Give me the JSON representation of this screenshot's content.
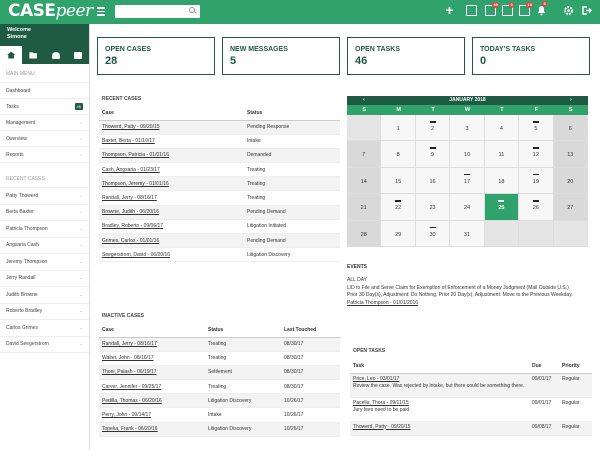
{
  "app": {
    "logo_case": "CASE",
    "logo_peer": "peer"
  },
  "topbar": {
    "search_placeholder": "",
    "badges": {
      "tasks": "40",
      "messages": "5",
      "inbox": "18",
      "alerts": "5"
    }
  },
  "sidebar": {
    "welcome": "Welcome",
    "user": "Simone",
    "main_menu_label": "MAIN MENU",
    "menu": [
      {
        "label": "Dashboard",
        "count": "",
        "chevron": false
      },
      {
        "label": "Tasks",
        "count": "46",
        "chevron": false
      },
      {
        "label": "Management",
        "count": "",
        "chevron": true
      },
      {
        "label": "Overview",
        "count": "",
        "chevron": true
      },
      {
        "label": "Reports",
        "count": "",
        "chevron": true
      }
    ],
    "recent_label": "RECENT CASES",
    "recent": [
      "Patty Thowerd",
      "Berta Baxter",
      "Patricia Thompson",
      "Angsaria Cash",
      "Jeremy Thompson",
      "Jerry Randall",
      "Judith Browne",
      "Roberto Bradley",
      "Carlos Grimes",
      "David Seegerstrom"
    ]
  },
  "cards": [
    {
      "label": "OPEN CASES",
      "value": "28"
    },
    {
      "label": "NEW MESSAGES",
      "value": "5"
    },
    {
      "label": "OPEN TASKS",
      "value": "46"
    },
    {
      "label": "TODAY'S TASKS",
      "value": "0"
    }
  ],
  "recent_cases": {
    "title": "RECENT CASES",
    "headers": [
      "Case",
      "Status"
    ],
    "rows": [
      [
        "Thowerd, Patty - 09/20/15",
        "Pending Response"
      ],
      [
        "Baxter, Berta - 01/10/17",
        "Intake"
      ],
      [
        "Thompson, Patricia - 01/01/16",
        "Demanded"
      ],
      [
        "Cash, Angsaria - 01/23/17",
        "Treating"
      ],
      [
        "Thompson, Jeremy - 01/01/16",
        "Treating"
      ],
      [
        "Randall, Jerry - 08/16/17",
        "Treating"
      ],
      [
        "Browne, Judith - 06/20/16",
        "Pending Demand"
      ],
      [
        "Bradley, Roberto - 09/06/17",
        "Litigation Initiated"
      ],
      [
        "Grimes, Carlos - 01/01/16",
        "Pending Demand"
      ],
      [
        "Seegerstrom, David - 06/20/16",
        "Litigation Discovery"
      ]
    ]
  },
  "inactive_cases": {
    "title": "INACTIVE CASES",
    "headers": [
      "Case",
      "Status",
      "Last Touched"
    ],
    "rows": [
      [
        "Randall, Jerry - 08/16/17",
        "Treating",
        "08/30/17"
      ],
      [
        "Walter, John - 08/16/17",
        "Treating",
        "08/30/17"
      ],
      [
        "Thoni, Palash - 06/19/17",
        "Settlement",
        "08/30/17"
      ],
      [
        "Carver, Jennifer - 09/25/17",
        "Treating",
        "08/30/17"
      ],
      [
        "Pedilla, Thomas - 06/20/16",
        "Litigation Discovery",
        "10/26/17"
      ],
      [
        "Perry, John - 09/14/17",
        "Intake",
        "10/26/17"
      ],
      [
        "Topeka, Frank - 06/20/16",
        "Litigation Discovery",
        "10/26/17"
      ]
    ]
  },
  "calendar": {
    "title": "JANUARY 2018",
    "prev": "‹",
    "next": "›",
    "days": [
      "S",
      "M",
      "T",
      "W",
      "T",
      "F",
      "S"
    ],
    "weeks": [
      [
        [
          "",
          0
        ],
        [
          "1",
          0
        ],
        [
          "2",
          1
        ],
        [
          "3",
          0
        ],
        [
          "4",
          0
        ],
        [
          "5",
          1
        ],
        [
          "6",
          0
        ]
      ],
      [
        [
          "7",
          0
        ],
        [
          "8",
          0
        ],
        [
          "9",
          1
        ],
        [
          "10",
          0
        ],
        [
          "11",
          0
        ],
        [
          "12",
          1
        ],
        [
          "13",
          0
        ]
      ],
      [
        [
          "14",
          0
        ],
        [
          "15",
          0
        ],
        [
          "16",
          0
        ],
        [
          "17",
          1
        ],
        [
          "18",
          0
        ],
        [
          "19",
          1
        ],
        [
          "20",
          0
        ]
      ],
      [
        [
          "21",
          0
        ],
        [
          "22",
          1
        ],
        [
          "23",
          0
        ],
        [
          "24",
          0
        ],
        [
          "25",
          1
        ],
        [
          "26",
          1
        ],
        [
          "27",
          0
        ]
      ],
      [
        [
          "28",
          0
        ],
        [
          "29",
          0
        ],
        [
          "30",
          1
        ],
        [
          "31",
          0
        ],
        [
          "",
          0
        ],
        [
          "",
          0
        ],
        [
          "",
          0
        ]
      ]
    ],
    "today": "25"
  },
  "events": {
    "title": "EVENTS",
    "line1": "ALL DAY",
    "line2": "L/D to File and Serve Claim for Exemption of Enforcement of a Money Judgment (Mail Outside U.S.)",
    "line3": "Prior 30 Day(s), Adjustment: Do Nothing, Prior 20 Day(s), Adjustment: Move to the Previous Weekday.",
    "link": "Patricia Thompson - 01/01/2016"
  },
  "open_tasks": {
    "title": "OPEN TASKS",
    "headers": [
      "Task",
      "Due",
      "Priority"
    ],
    "rows": [
      {
        "link": "Price, Leo - 03/01/17",
        "desc": "Review the case. Was rejected by intake, but there could be something there.",
        "due": "09/01/17",
        "priority": "Regular"
      },
      {
        "link": "Pacella, Thora - 09/11/15",
        "desc": "Jury fees need to be paid",
        "due": "09/01/17",
        "priority": "Regular"
      },
      {
        "link": "Thowerd, Patty - 09/20/15",
        "desc": "",
        "due": "09/08/17",
        "priority": "Regular"
      }
    ]
  }
}
